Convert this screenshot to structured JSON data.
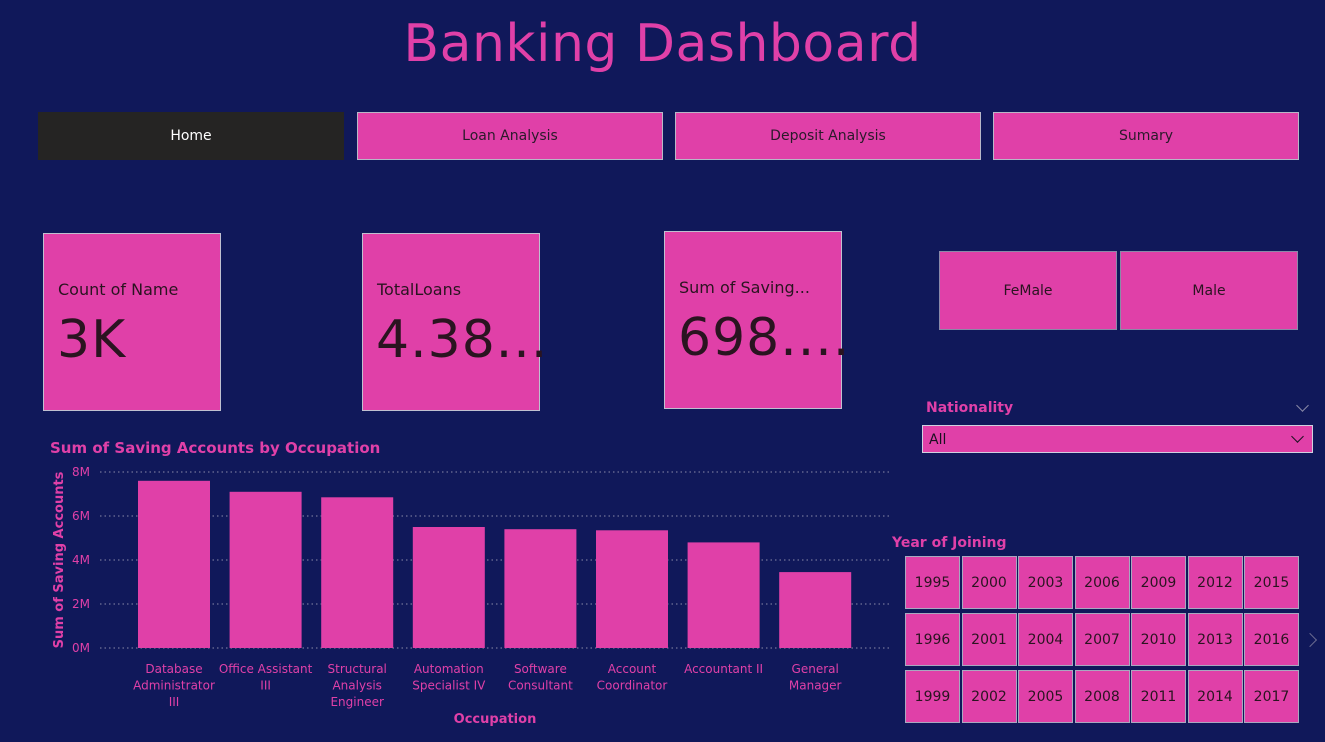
{
  "header": {
    "title": "Banking Dashboard"
  },
  "nav": [
    {
      "label": "Home",
      "active": true
    },
    {
      "label": "Loan Analysis",
      "active": false
    },
    {
      "label": "Deposit Analysis",
      "active": false
    },
    {
      "label": "Sumary",
      "active": false
    }
  ],
  "cards": [
    {
      "label": "Count of Name",
      "value": "3K"
    },
    {
      "label": "TotalLoans",
      "value": "4.38..."
    },
    {
      "label": "Sum of Saving...",
      "value": "698...."
    }
  ],
  "gender": [
    "FeMale",
    "Male"
  ],
  "nationality": {
    "title": "Nationality",
    "selected": "All"
  },
  "year_slicer": {
    "title": "Year of Joining",
    "years": [
      "1995",
      "2000",
      "2003",
      "2006",
      "2009",
      "2012",
      "2015",
      "1996",
      "2001",
      "2004",
      "2007",
      "2010",
      "2013",
      "2016",
      "1999",
      "2002",
      "2005",
      "2008",
      "2011",
      "2014",
      "2017"
    ]
  },
  "colors": {
    "background": "#10185a",
    "accent": "#e040a8",
    "active_tab": "#252423"
  },
  "chart_data": {
    "type": "bar",
    "title": "Sum of Saving Accounts by Occupation",
    "xlabel": "Occupation",
    "ylabel": "Sum of Saving Accounts",
    "categories": [
      [
        "Database",
        "Administrator",
        "III"
      ],
      [
        "Office Assistant",
        "III"
      ],
      [
        "Structural",
        "Analysis",
        "Engineer"
      ],
      [
        "Automation",
        "Specialist IV"
      ],
      [
        "Software",
        "Consultant"
      ],
      [
        "Account",
        "Coordinator"
      ],
      [
        "Accountant II"
      ],
      [
        "General",
        "Manager"
      ]
    ],
    "values": [
      7.6,
      7.1,
      6.85,
      5.5,
      5.4,
      5.35,
      4.8,
      3.45
    ],
    "value_unit": "M",
    "ylim": [
      0,
      8
    ],
    "yticks": [
      "0M",
      "2M",
      "4M",
      "6M",
      "8M"
    ],
    "grid": true
  }
}
